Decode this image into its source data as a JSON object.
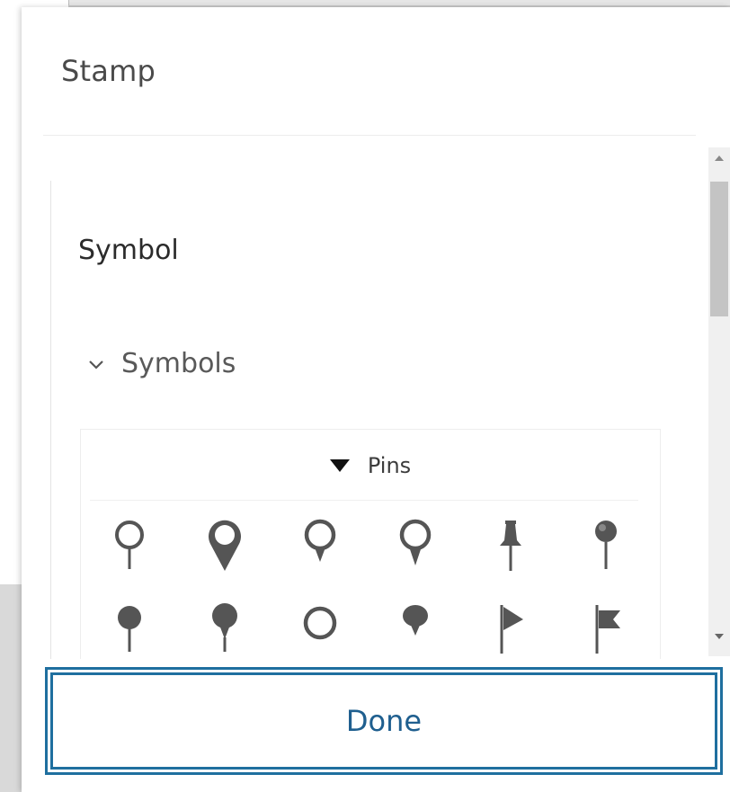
{
  "dialog": {
    "title": "Stamp"
  },
  "panel": {
    "heading": "Symbol",
    "section_label": "Symbols",
    "section_expanded": true,
    "gallery": {
      "category": "Pins",
      "symbols": [
        {
          "name": "pin-outline-thin-icon"
        },
        {
          "name": "pin-outline-bold-icon"
        },
        {
          "name": "pin-outline-medium-icon"
        },
        {
          "name": "pin-outline-tapered-icon"
        },
        {
          "name": "pushpin-icon"
        },
        {
          "name": "map-tack-icon"
        },
        {
          "name": "pin-filled-round-icon"
        },
        {
          "name": "pin-filled-large-icon"
        },
        {
          "name": "pin-ring-icon"
        },
        {
          "name": "pin-filled-flat-icon"
        },
        {
          "name": "flag-pennant-icon"
        },
        {
          "name": "flag-swallowtail-icon"
        }
      ]
    }
  },
  "footer": {
    "done_label": "Done"
  },
  "colors": {
    "accent": "#1f6f9f",
    "icon": "#555555"
  }
}
